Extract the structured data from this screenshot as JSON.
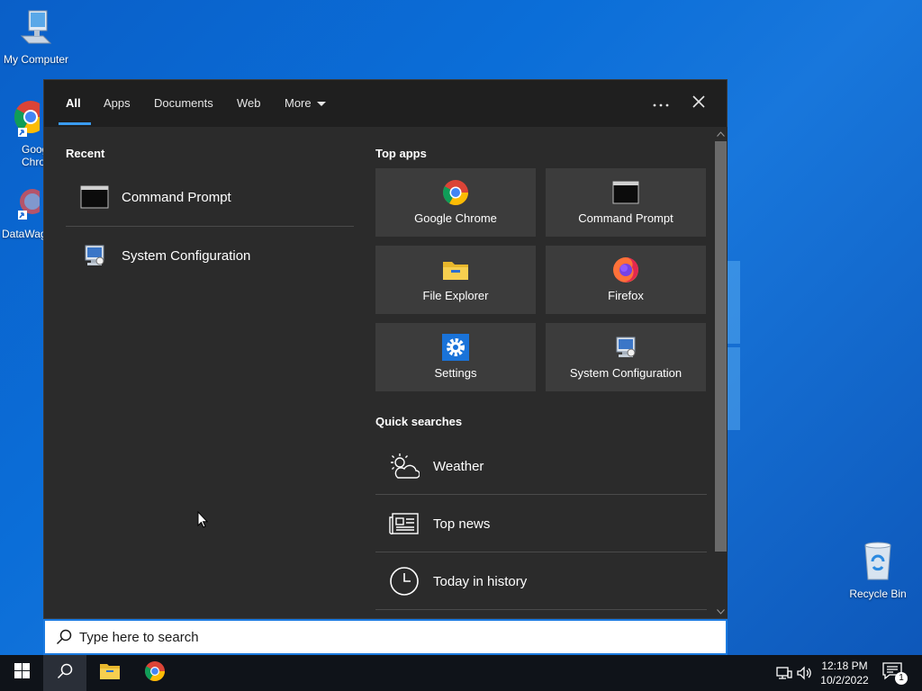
{
  "desktop": {
    "icons": [
      {
        "label": "My Computer"
      },
      {
        "label": "Goog Chron"
      },
      {
        "label": "DataWag"
      },
      {
        "label": "Recycle Bin"
      }
    ]
  },
  "search_panel": {
    "tabs": [
      {
        "label": "All",
        "active": true
      },
      {
        "label": "Apps"
      },
      {
        "label": "Documents"
      },
      {
        "label": "Web"
      },
      {
        "label": "More"
      }
    ],
    "more_options_icon": "ellipsis-icon",
    "close_icon": "close-icon",
    "recent": {
      "title": "Recent",
      "items": [
        {
          "label": "Command Prompt",
          "icon": "command-prompt-icon"
        },
        {
          "label": "System Configuration",
          "icon": "system-configuration-icon"
        }
      ]
    },
    "top_apps": {
      "title": "Top apps",
      "items": [
        {
          "label": "Google Chrome",
          "icon": "chrome-icon"
        },
        {
          "label": "Command Prompt",
          "icon": "command-prompt-icon"
        },
        {
          "label": "File Explorer",
          "icon": "folder-icon"
        },
        {
          "label": "Firefox",
          "icon": "firefox-icon"
        },
        {
          "label": "Settings",
          "icon": "gear-icon"
        },
        {
          "label": "System Configuration",
          "icon": "system-configuration-icon"
        }
      ]
    },
    "quick_searches": {
      "title": "Quick searches",
      "items": [
        {
          "label": "Weather",
          "icon": "weather-icon"
        },
        {
          "label": "Top news",
          "icon": "news-icon"
        },
        {
          "label": "Today in history",
          "icon": "clock-icon"
        }
      ]
    }
  },
  "search_box": {
    "placeholder": "Type here to search",
    "icon": "search-icon"
  },
  "taskbar": {
    "start_icon": "windows-icon",
    "pinned": [
      "search-icon",
      "file-explorer-icon",
      "chrome-icon"
    ],
    "tray": [
      "network-icon",
      "volume-icon"
    ],
    "time": "12:18 PM",
    "date": "10/2/2022",
    "notifications_count": "1"
  },
  "colors": {
    "accent": "#3a9bf0",
    "panel_bg": "#2b2b2b",
    "tile_bg": "#3c3c3c",
    "taskbar_bg": "#0f1319"
  }
}
